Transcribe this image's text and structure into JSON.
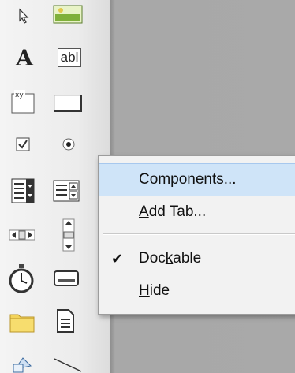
{
  "toolbox": {
    "label_tool_glyph": "A",
    "textbox_tool_glyph": "abl",
    "frame_tool_glyph": "xy"
  },
  "context_menu": {
    "items": [
      {
        "pre": "C",
        "u": "o",
        "post": "mponents...",
        "highlighted": true,
        "checked": false
      },
      {
        "pre": "",
        "u": "A",
        "post": "dd Tab...",
        "highlighted": false,
        "checked": false
      },
      {
        "pre": "Doc",
        "u": "k",
        "post": "able",
        "highlighted": false,
        "checked": true
      },
      {
        "pre": "",
        "u": "H",
        "post": "ide",
        "highlighted": false,
        "checked": false
      }
    ],
    "check_mark": "✔"
  },
  "colors": {
    "highlight": "#cfe4f8",
    "client_area": "#a9a9a9",
    "menu_bg": "#f2f2f2"
  },
  "icons": [
    "pointer-icon",
    "picture-icon",
    "label-icon",
    "textbox-icon",
    "frame-icon",
    "command-button-icon",
    "checkbox-icon",
    "option-button-icon",
    "combobox-icon",
    "listbox-icon",
    "hscrollbar-icon",
    "vscrollbar-icon",
    "timer-icon",
    "drive-listbox-icon",
    "dir-listbox-icon",
    "file-listbox-icon",
    "shape-icon",
    "line-icon"
  ]
}
